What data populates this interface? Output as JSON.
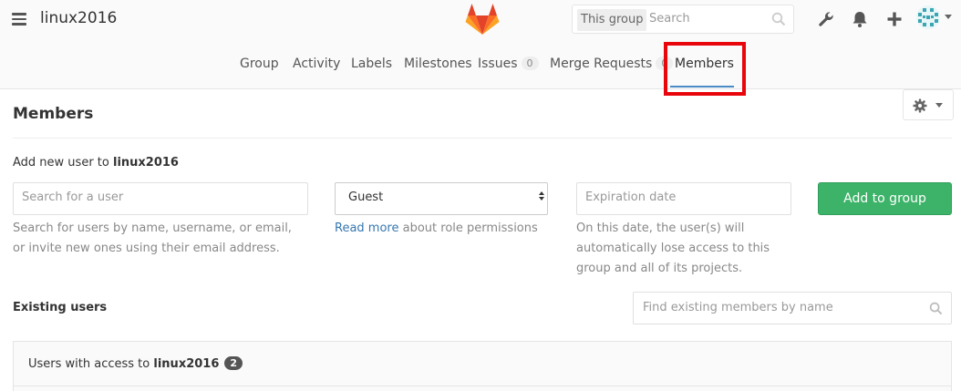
{
  "header": {
    "group_name": "linux2016",
    "search_scope": "This group",
    "search_placeholder": "Search"
  },
  "subnav": {
    "items": [
      {
        "label": "Group"
      },
      {
        "label": "Activity"
      },
      {
        "label": "Labels"
      },
      {
        "label": "Milestones"
      },
      {
        "label": "Issues",
        "count": "0"
      },
      {
        "label": "Merge Requests",
        "count": "0"
      },
      {
        "label": "Members",
        "active": true
      }
    ]
  },
  "page": {
    "title": "Members",
    "add_new_prefix": "Add new user to",
    "add_new_group": "linux2016",
    "user_search_placeholder": "Search for a user",
    "role_selected": "Guest",
    "expiration_placeholder": "Expiration date",
    "add_button": "Add to group",
    "user_help": "Search for users by name, username, or email, or invite new ones using their email address.",
    "role_help_link": "Read more",
    "role_help_text": " about role permissions",
    "expiration_help": "On this date, the user(s) will automatically lose access to this group and all of its projects.",
    "existing_title": "Existing users",
    "find_placeholder": "Find existing members by name",
    "panel_prefix": "Users with access to",
    "panel_group": "linux2016",
    "member_count": "2"
  },
  "colors": {
    "accent": "#4a8bc7",
    "highlight": "#e8060c",
    "button_green": "#3cb368",
    "link": "#3777b0"
  },
  "icons": [
    "hamburger-icon",
    "gitlab-logo",
    "search-icon",
    "wrench-icon",
    "bell-icon",
    "plus-icon",
    "user-avatar",
    "gear-icon",
    "chevron-down-icon"
  ]
}
